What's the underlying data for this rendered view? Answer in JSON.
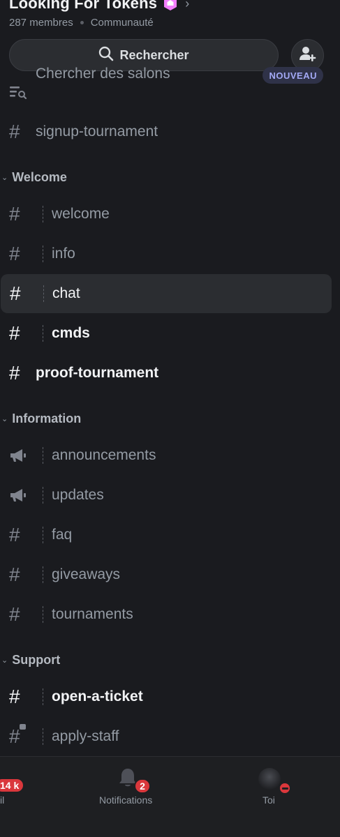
{
  "server": {
    "name": "Looking For Tokens",
    "members": "287 membres",
    "type": "Communauté"
  },
  "search": {
    "label": "Rechercher"
  },
  "browse": {
    "label": "Chercher des salons",
    "badge": "NOUVEAU"
  },
  "channels_top": [
    {
      "name": "signup-tournament",
      "icon": "hash-icon"
    }
  ],
  "categories": {
    "welcome": "Welcome",
    "information": "Information",
    "support": "Support"
  },
  "welcome_channels": [
    {
      "name": "welcome",
      "icon": "hash-icon"
    },
    {
      "name": "info",
      "icon": "hash-icon"
    },
    {
      "name": "chat",
      "icon": "hash-icon"
    },
    {
      "name": "cmds",
      "icon": "hash-icon"
    },
    {
      "name": "proof-tournament",
      "icon": "hash-icon"
    }
  ],
  "information_channels": [
    {
      "name": "announcements",
      "icon": "megaphone-icon"
    },
    {
      "name": "updates",
      "icon": "megaphone-icon"
    },
    {
      "name": "faq",
      "icon": "hash-icon"
    },
    {
      "name": "giveaways",
      "icon": "hash-icon"
    },
    {
      "name": "tournaments",
      "icon": "hash-icon"
    }
  ],
  "support_channels": [
    {
      "name": "open-a-ticket",
      "icon": "hash-icon"
    },
    {
      "name": "apply-staff",
      "icon": "locked-hash-icon"
    }
  ],
  "bottom_nav": {
    "home_badge": "14 k",
    "home_label": "il",
    "notifications_label": "Notifications",
    "notifications_badge": "2",
    "you_label": "Toi"
  },
  "colors": {
    "background": "#1a1b1f",
    "active_row": "#2b2d31",
    "badge_red": "#da373c",
    "new_badge_text": "#a3a9f5",
    "boost_pink": "#f47fff"
  }
}
